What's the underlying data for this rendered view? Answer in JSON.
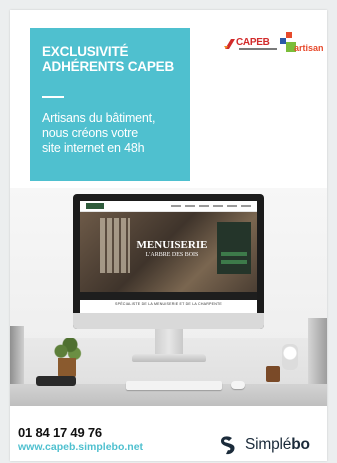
{
  "headline": {
    "line1": "EXCLUSIVITÉ",
    "line2": "ADHÉRENTS CAPEB"
  },
  "tagline": {
    "line1": "Artisans du bâtiment,",
    "line2": "nous créons votre",
    "line3": "site internet en 48h"
  },
  "logos": {
    "capeb": "CAPEB",
    "artisan": "artisan"
  },
  "screen": {
    "hero_title_1": "MENUISERIE",
    "hero_title_2": "L'ARBRE DES BOIS",
    "caption": "SPÉCIALISTE DE LA MENUISERIE ET DE LA CHARPENTE"
  },
  "footer": {
    "phone": "01 84 17 49 76",
    "url": "www.capeb.simplebo.net",
    "brand_prefix": "Simplé",
    "brand_suffix": "bo"
  },
  "colors": {
    "accent_teal": "#4fc0cf",
    "capeb_red": "#d22b2b",
    "brand_navy": "#1b2b3a"
  }
}
